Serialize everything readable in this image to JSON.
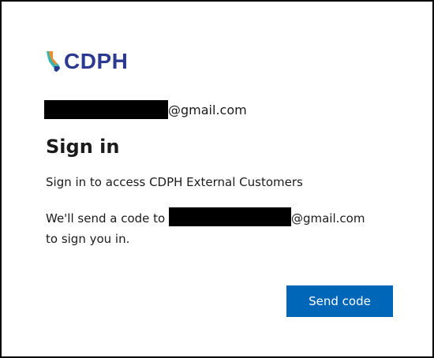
{
  "brand": {
    "name": "CDPH",
    "logo_icon": "california-state-icon",
    "colors": {
      "brand_navy": "#2b3990",
      "brand_orange": "#f28c28",
      "brand_teal": "#39b5b0"
    }
  },
  "account": {
    "email_domain": "@gmail.com"
  },
  "heading": "Sign in",
  "description": "Sign in to access CDPH External Customers",
  "code_message": {
    "prefix": "We'll send a code to ",
    "email_domain": "@gmail.com",
    "suffix": "to sign you in."
  },
  "actions": {
    "send_code_label": "Send code",
    "button_color": "#0067b8"
  }
}
